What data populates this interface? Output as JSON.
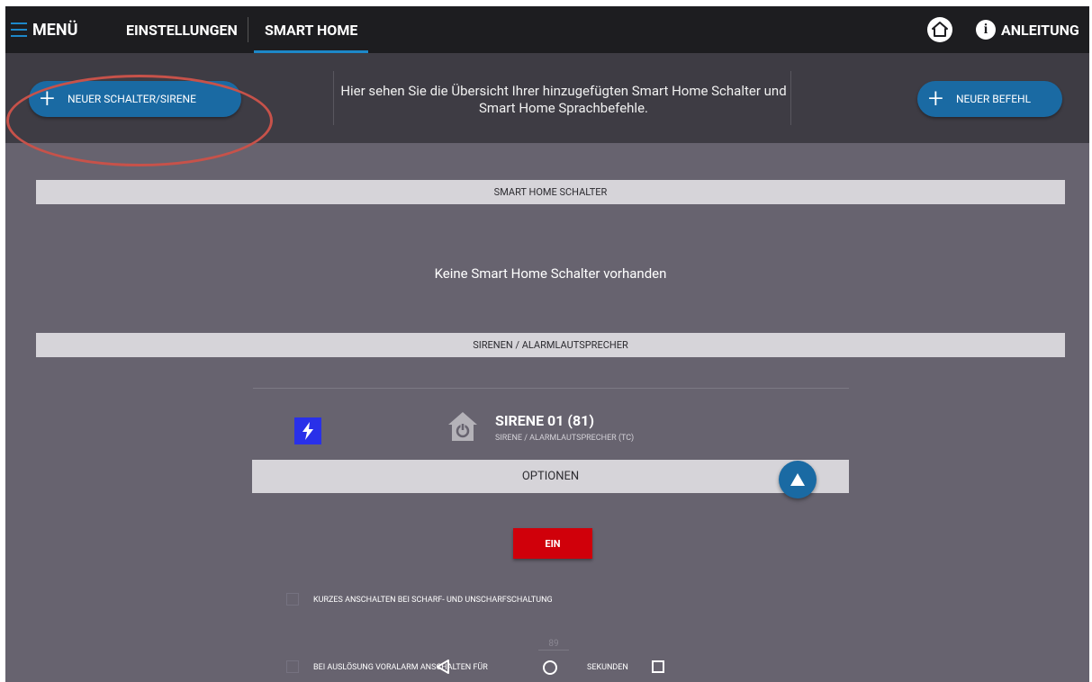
{
  "topbar": {
    "menu_label": "MENÜ",
    "tabs": [
      {
        "label": "EINSTELLUNGEN"
      },
      {
        "label": "SMART HOME",
        "active": true
      }
    ],
    "help_label": "ANLEITUNG"
  },
  "header": {
    "add_switch_label": "NEUER SCHALTER/SIRENE",
    "description": "Hier sehen Sie die Übersicht Ihrer hinzugefügten Smart Home Schalter und Smart Home Sprachbefehle.",
    "add_command_label": "NEUER BEFEHL"
  },
  "sections": {
    "switches": {
      "title": "SMART HOME SCHALTER",
      "empty_message": "Keine Smart Home Schalter vorhanden"
    },
    "sirens": {
      "title": "SIRENEN / ALARMLAUTSPRECHER"
    }
  },
  "device": {
    "name": "SIRENE 01 (81)",
    "type": "SIRENE / ALARMLAUTSPRECHER (TC)",
    "options_label": "OPTIONEN",
    "on_button_label": "EIN",
    "option_short_switch": "KURZES ANSCHALTEN BEI SCHARF- UND UNSCHARFSCHALTUNG",
    "option_prealarm": "BEI AUSLÖSUNG VORALARM ANSCHALTEN FÜR",
    "prealarm_seconds": "89",
    "seconds_label": "SEKUNDEN"
  },
  "colors": {
    "accent": "#1a6aa3",
    "topbar": "#1d1d20",
    "header": "#3e3c44",
    "content": "#67636f",
    "danger": "#d0000a",
    "annotation": "#c7524a"
  },
  "icons": [
    "hamburger-menu-icon",
    "home-icon",
    "info-icon",
    "plus-icon",
    "lightning-bolt-icon",
    "power-home-icon",
    "chevron-up-icon",
    "nav-back-icon",
    "nav-home-icon"
  ]
}
